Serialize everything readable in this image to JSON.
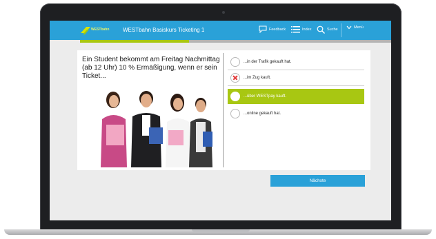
{
  "app": {
    "logo_text": "WESTbahn",
    "course_title": "WESTbahn Basiskurs Ticketing 1"
  },
  "toolbar": {
    "feedback_label": "Feedback",
    "index_label": "Index",
    "search_label": "Suche",
    "menu_label": "Menü"
  },
  "progress": {
    "fraction": 0.35
  },
  "question": {
    "text": "Ein Student bekommt am Freitag Nachmittag (ab 12 Uhr) 10 % Ermäßigung, wenn er sein Ticket..."
  },
  "answers": [
    {
      "text": "...in der Trafik gekauft hat.",
      "state": "neutral"
    },
    {
      "text": "...im Zug kauft.",
      "state": "wrong"
    },
    {
      "text": "...über WESTpay kauft.",
      "state": "correct"
    },
    {
      "text": "...online gekauft hat.",
      "state": "neutral"
    }
  ],
  "actions": {
    "next_label": "Nächste"
  },
  "colors": {
    "brand_blue": "#2aa1d8",
    "accent_green": "#a8c712",
    "wrong_red": "#e23b3b"
  },
  "icons": [
    "feedback-icon",
    "index-icon",
    "search-icon",
    "chevron-down-icon",
    "logo"
  ]
}
